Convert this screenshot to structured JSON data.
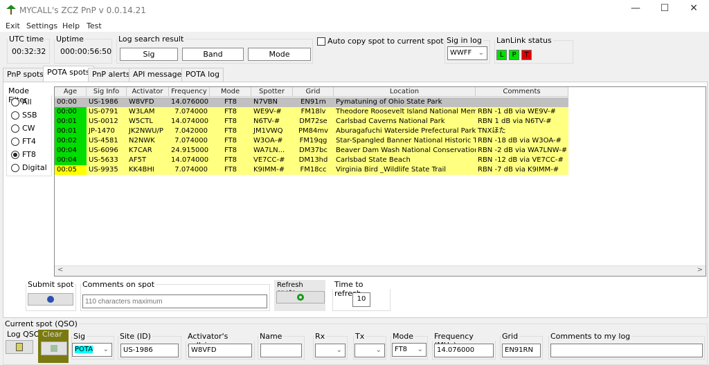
{
  "window": {
    "title": "MYCALL's ZCZ PnP v  0.0.14.21",
    "minimize": "—",
    "maximize": "☐",
    "close": "✕"
  },
  "menu": [
    "Exit",
    "Settings",
    "Help",
    "Test"
  ],
  "utc": {
    "label": "UTC time",
    "value": "00:32:32"
  },
  "uptime": {
    "label": "Uptime",
    "value": "000:00:56:50"
  },
  "log_search": {
    "label": "Log search result",
    "buttons": [
      "Sig",
      "Band",
      "Mode"
    ]
  },
  "auto_copy": {
    "label": "Auto copy spot to current spot",
    "checked": false
  },
  "sig_in_log": {
    "label": "Sig in log",
    "value": "WWFF"
  },
  "lanlink": {
    "label": "LanLink status",
    "leds": [
      {
        "t": "L",
        "color": "#00e000"
      },
      {
        "t": "P",
        "color": "#00e000"
      },
      {
        "t": "T",
        "color": "#e00000"
      }
    ]
  },
  "tabs": [
    "PnP spots",
    "POTA spots",
    "PnP alerts",
    "API messages",
    "POTA log"
  ],
  "active_tab": "POTA spots",
  "mode_filter": {
    "label": "Mode Filter",
    "options": [
      "All",
      "SSB",
      "CW",
      "FT4",
      "FT8",
      "Digital"
    ],
    "selected": "FT8"
  },
  "table": {
    "columns": [
      "Age",
      "Sig Info",
      "Activator",
      "Frequency",
      "Mode",
      "Spotter",
      "Grid",
      "Location",
      "Comments"
    ],
    "rows": [
      [
        "00:00",
        "US-1986",
        "W8VFD",
        "14.076000",
        "FT8",
        "N7VBN",
        "EN91rn",
        "Pymatuning of Ohio State Park",
        ""
      ],
      [
        "00:00",
        "US-0791",
        "W3LAM",
        "7.074000",
        "FT8",
        "WE9V-#",
        "FM18lv",
        "Theodore Roosevelt Island National Memo...",
        "RBN -1 dB via WE9V-#"
      ],
      [
        "00:01",
        "US-0012",
        "W5CTL",
        "14.074000",
        "FT8",
        "N6TV-#",
        "DM72se",
        "Carlsbad Caverns National Park",
        "RBN 1 dB via N6TV-#"
      ],
      [
        "00:01",
        "JP-1470",
        "JK2NWU/P",
        "7.042000",
        "FT8",
        "JM1VWQ",
        "PM84mv",
        "Aburagafuchi Waterside Prefectural Park",
        "TNXほた"
      ],
      [
        "00:02",
        "US-4581",
        "N2NWK",
        "7.074000",
        "FT8",
        "W3OA-#",
        "FM19qg",
        "Star-Spangled Banner National Historic Trail",
        "RBN -18 dB via W3OA-#"
      ],
      [
        "00:04",
        "US-6096",
        "K7CAR",
        "24.915000",
        "FT8",
        "WA7LN...",
        "DM37bc",
        "Beaver Dam Wash National Conservation ...",
        "RBN -2 dB via WA7LNW-#"
      ],
      [
        "00:04",
        "US-5633",
        "AF5T",
        "14.074000",
        "FT8",
        "VE7CC-#",
        "DM13hd",
        "Carlsbad State Beach",
        "RBN -12 dB via VE7CC-#"
      ],
      [
        "00:05",
        "US-9935",
        "KK4BHI",
        "7.074000",
        "FT8",
        "K9IMM-#",
        "FM18cc",
        "Virginia Bird _Wildlife State Trail",
        "RBN -7 dB via K9IMM-#"
      ]
    ],
    "age_colors": [
      "#c0c0c0",
      "#00dd00",
      "#00dd00",
      "#00dd00",
      "#00dd00",
      "#00dd00",
      "#00dd00",
      "#ffff00"
    ],
    "selected_row_color": "#c0c0c0",
    "row_color": "#ffff80"
  },
  "submit": {
    "label": "Submit spot"
  },
  "comments_spot": {
    "label": "Comments on spot",
    "placeholder": "110 characters maximum"
  },
  "refresh": {
    "label": "Refresh spots"
  },
  "time_refresh": {
    "label": "Time to refresh",
    "value": "10"
  },
  "current": {
    "label": "Current spot (QSO)",
    "log_qso": "Log QSO",
    "clear": "Clear",
    "sig": {
      "label": "Sig",
      "value": "POTA"
    },
    "site": {
      "label": "Site (ID)",
      "value": "US-1986"
    },
    "callsign": {
      "label": "Activator's callsign",
      "value": "W8VFD"
    },
    "name": {
      "label": "Name",
      "value": ""
    },
    "rx": {
      "label": "Rx",
      "value": ""
    },
    "tx": {
      "label": "Tx",
      "value": ""
    },
    "mode": {
      "label": "Mode",
      "value": "FT8"
    },
    "freq": {
      "label": "Frequency (MHz)",
      "value": "14.076000"
    },
    "grid": {
      "label": "Grid",
      "value": "EN91RN"
    },
    "comments": {
      "label": "Comments to my log",
      "value": ""
    }
  }
}
